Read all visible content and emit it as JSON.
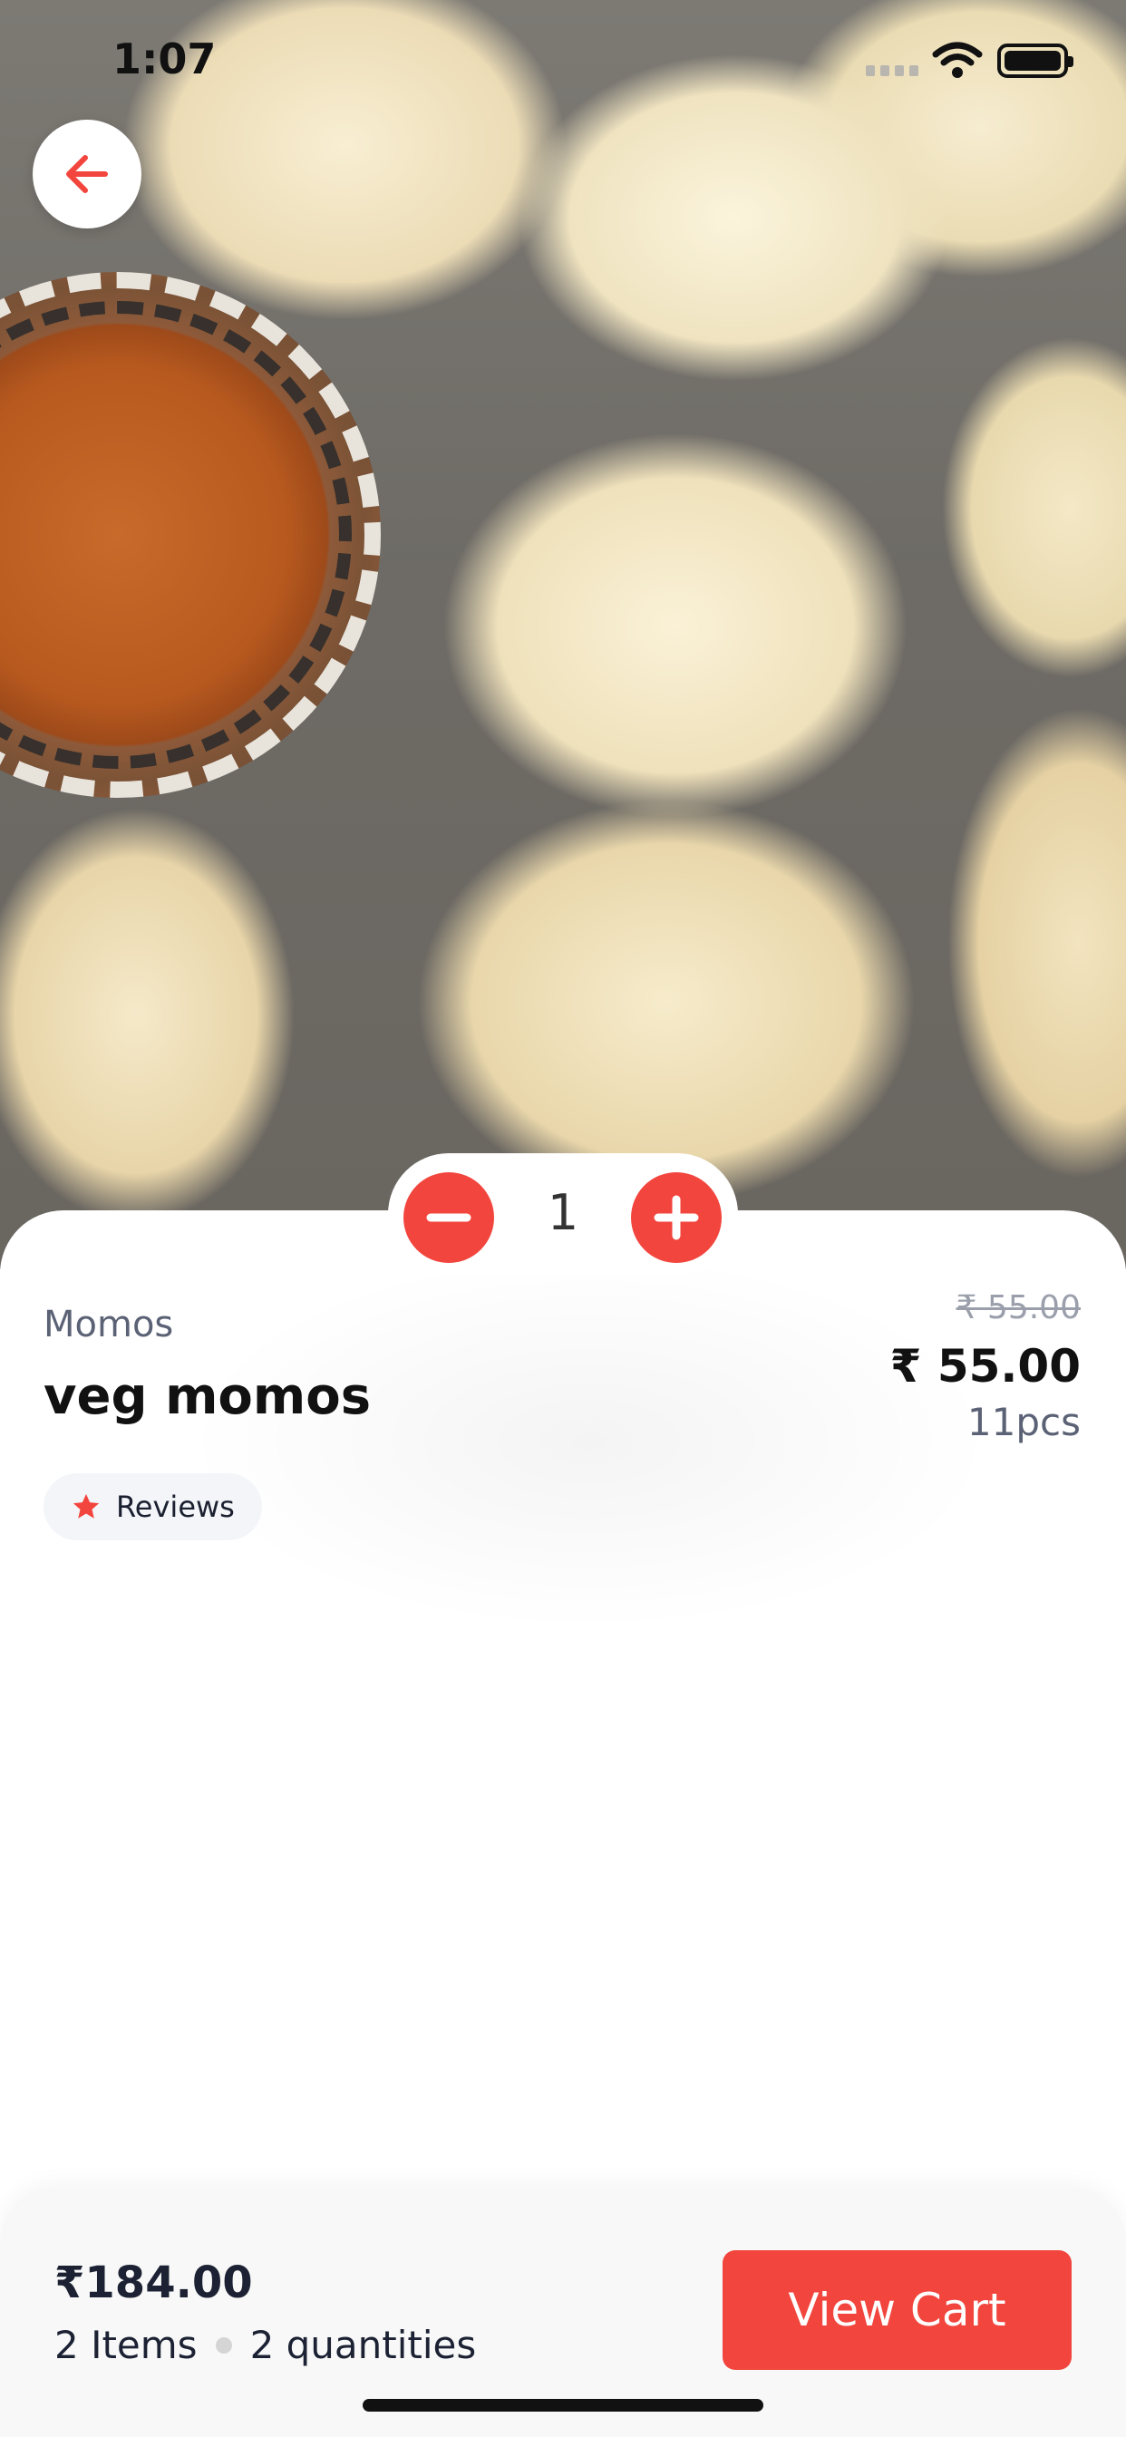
{
  "status_bar": {
    "time": "1:07"
  },
  "product": {
    "category": "Momos",
    "name": "veg momos",
    "original_price": "₹ 55.00",
    "price": "₹ 55.00",
    "pieces": "11pcs",
    "quantity": "1"
  },
  "reviews": {
    "label": "Reviews"
  },
  "cart": {
    "total": "₹184.00",
    "items": "2 Items",
    "quantities": "2 quantities",
    "button_label": "View Cart"
  },
  "colors": {
    "accent": "#f2453d",
    "text_primary": "#111111",
    "text_secondary": "#5b6275"
  },
  "icons": [
    "arrow-left-icon",
    "minus-icon",
    "plus-icon",
    "star-icon",
    "wifi-icon",
    "battery-icon",
    "signal-icon"
  ]
}
